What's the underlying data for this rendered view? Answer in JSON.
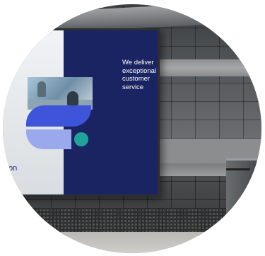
{
  "scene": {
    "subject": "billboard-in-subway-corridor"
  },
  "billboard": {
    "tagline": "We deliver\nexceptional\ncustomer\nservice",
    "text_fragment": "on",
    "colors": {
      "panel": "#1b2463",
      "logo_primary": "#3e55d9",
      "logo_secondary": "#9aa8ec",
      "logo_dot": "#1fa39a"
    }
  }
}
